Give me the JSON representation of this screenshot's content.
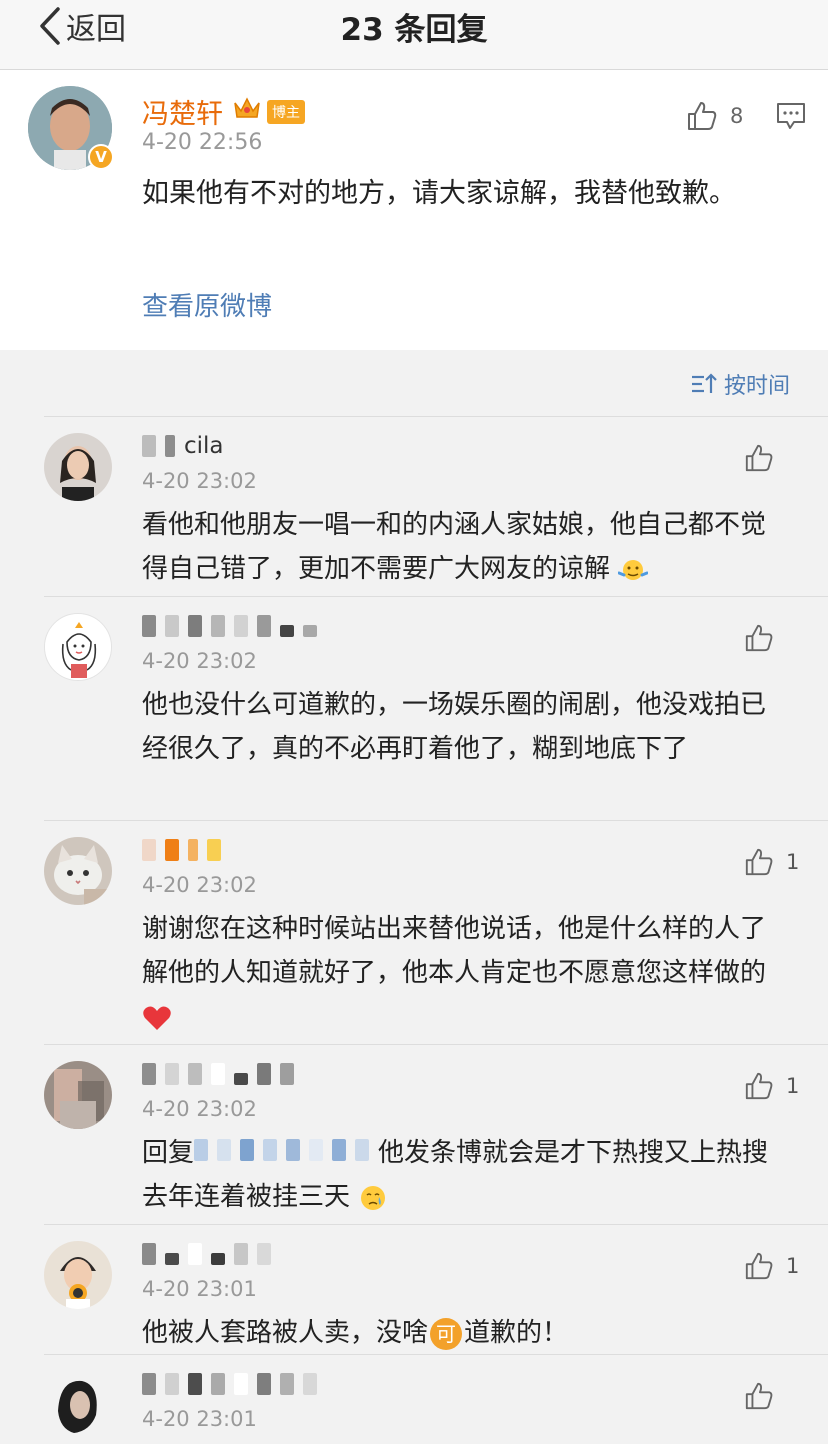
{
  "nav": {
    "back_label": "返回",
    "title": "23 条回复"
  },
  "post": {
    "author": "冯楚轩",
    "host_tag": "博主",
    "time": "4-20 22:56",
    "like_count": "8",
    "text": "如果他有不对的地方，请大家谅解，我替他致歉。",
    "view_original": "查看原微博",
    "verified_mark": "V"
  },
  "sort": {
    "label": "按时间"
  },
  "comments": [
    {
      "name_visible": "cila",
      "time": "4-20 23:02",
      "likes": "",
      "text": "看他和他朋友一唱一和的内涵人家姑娘，他自己都不觉得自己错了，更加不需要广大网友的谅解"
    },
    {
      "time": "4-20 23:02",
      "likes": "",
      "text": "他也没什么可道歉的，一场娱乐圈的闹剧，他没戏拍已经很久了，真的不必再盯着他了，糊到地底下了"
    },
    {
      "time": "4-20 23:02",
      "likes": "1",
      "text": "谢谢您在这种时候站出来替他说话，他是什么样的人了解他的人知道就好了，他本人肯定也不愿意您这样做的"
    },
    {
      "time": "4-20 23:02",
      "likes": "1",
      "reply_prefix": "回复",
      "text": "他发条博就会是才下热搜又上热搜 去年连着被挂三天"
    },
    {
      "time": "4-20 23:01",
      "likes": "1",
      "text_a": "他被人套路被人卖，没啥",
      "ke": "可",
      "text_b": "道歉的！"
    },
    {
      "time": "4-20 23:01",
      "likes": ""
    }
  ],
  "colors": {
    "accent": "#4f7db5",
    "author_name": "#e86b0a",
    "badge": "#f6a623"
  },
  "icons": [
    "back-chevron-icon",
    "crown-icon",
    "thumbs-up-icon",
    "comment-icon",
    "sort-icon",
    "shrug-emoji-icon",
    "heart-emoji-icon",
    "crying-emoji-icon"
  ]
}
